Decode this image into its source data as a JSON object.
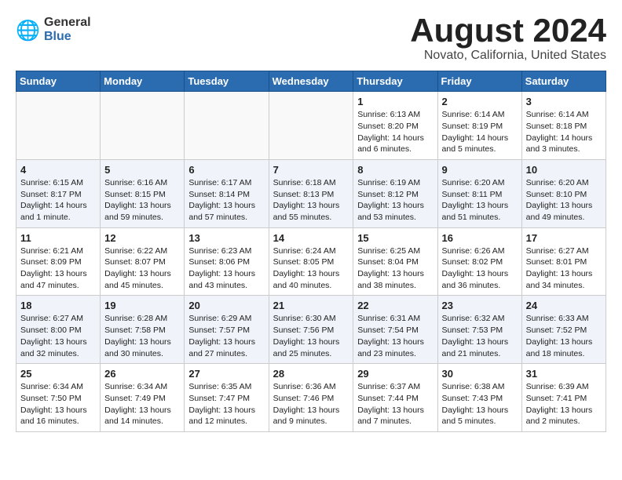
{
  "logo": {
    "general": "General",
    "blue": "Blue"
  },
  "title": {
    "month_year": "August 2024",
    "location": "Novato, California, United States"
  },
  "calendar": {
    "headers": [
      "Sunday",
      "Monday",
      "Tuesday",
      "Wednesday",
      "Thursday",
      "Friday",
      "Saturday"
    ],
    "weeks": [
      [
        {
          "day": "",
          "info": ""
        },
        {
          "day": "",
          "info": ""
        },
        {
          "day": "",
          "info": ""
        },
        {
          "day": "",
          "info": ""
        },
        {
          "day": "1",
          "info": "Sunrise: 6:13 AM\nSunset: 8:20 PM\nDaylight: 14 hours\nand 6 minutes."
        },
        {
          "day": "2",
          "info": "Sunrise: 6:14 AM\nSunset: 8:19 PM\nDaylight: 14 hours\nand 5 minutes."
        },
        {
          "day": "3",
          "info": "Sunrise: 6:14 AM\nSunset: 8:18 PM\nDaylight: 14 hours\nand 3 minutes."
        }
      ],
      [
        {
          "day": "4",
          "info": "Sunrise: 6:15 AM\nSunset: 8:17 PM\nDaylight: 14 hours\nand 1 minute."
        },
        {
          "day": "5",
          "info": "Sunrise: 6:16 AM\nSunset: 8:15 PM\nDaylight: 13 hours\nand 59 minutes."
        },
        {
          "day": "6",
          "info": "Sunrise: 6:17 AM\nSunset: 8:14 PM\nDaylight: 13 hours\nand 57 minutes."
        },
        {
          "day": "7",
          "info": "Sunrise: 6:18 AM\nSunset: 8:13 PM\nDaylight: 13 hours\nand 55 minutes."
        },
        {
          "day": "8",
          "info": "Sunrise: 6:19 AM\nSunset: 8:12 PM\nDaylight: 13 hours\nand 53 minutes."
        },
        {
          "day": "9",
          "info": "Sunrise: 6:20 AM\nSunset: 8:11 PM\nDaylight: 13 hours\nand 51 minutes."
        },
        {
          "day": "10",
          "info": "Sunrise: 6:20 AM\nSunset: 8:10 PM\nDaylight: 13 hours\nand 49 minutes."
        }
      ],
      [
        {
          "day": "11",
          "info": "Sunrise: 6:21 AM\nSunset: 8:09 PM\nDaylight: 13 hours\nand 47 minutes."
        },
        {
          "day": "12",
          "info": "Sunrise: 6:22 AM\nSunset: 8:07 PM\nDaylight: 13 hours\nand 45 minutes."
        },
        {
          "day": "13",
          "info": "Sunrise: 6:23 AM\nSunset: 8:06 PM\nDaylight: 13 hours\nand 43 minutes."
        },
        {
          "day": "14",
          "info": "Sunrise: 6:24 AM\nSunset: 8:05 PM\nDaylight: 13 hours\nand 40 minutes."
        },
        {
          "day": "15",
          "info": "Sunrise: 6:25 AM\nSunset: 8:04 PM\nDaylight: 13 hours\nand 38 minutes."
        },
        {
          "day": "16",
          "info": "Sunrise: 6:26 AM\nSunset: 8:02 PM\nDaylight: 13 hours\nand 36 minutes."
        },
        {
          "day": "17",
          "info": "Sunrise: 6:27 AM\nSunset: 8:01 PM\nDaylight: 13 hours\nand 34 minutes."
        }
      ],
      [
        {
          "day": "18",
          "info": "Sunrise: 6:27 AM\nSunset: 8:00 PM\nDaylight: 13 hours\nand 32 minutes."
        },
        {
          "day": "19",
          "info": "Sunrise: 6:28 AM\nSunset: 7:58 PM\nDaylight: 13 hours\nand 30 minutes."
        },
        {
          "day": "20",
          "info": "Sunrise: 6:29 AM\nSunset: 7:57 PM\nDaylight: 13 hours\nand 27 minutes."
        },
        {
          "day": "21",
          "info": "Sunrise: 6:30 AM\nSunset: 7:56 PM\nDaylight: 13 hours\nand 25 minutes."
        },
        {
          "day": "22",
          "info": "Sunrise: 6:31 AM\nSunset: 7:54 PM\nDaylight: 13 hours\nand 23 minutes."
        },
        {
          "day": "23",
          "info": "Sunrise: 6:32 AM\nSunset: 7:53 PM\nDaylight: 13 hours\nand 21 minutes."
        },
        {
          "day": "24",
          "info": "Sunrise: 6:33 AM\nSunset: 7:52 PM\nDaylight: 13 hours\nand 18 minutes."
        }
      ],
      [
        {
          "day": "25",
          "info": "Sunrise: 6:34 AM\nSunset: 7:50 PM\nDaylight: 13 hours\nand 16 minutes."
        },
        {
          "day": "26",
          "info": "Sunrise: 6:34 AM\nSunset: 7:49 PM\nDaylight: 13 hours\nand 14 minutes."
        },
        {
          "day": "27",
          "info": "Sunrise: 6:35 AM\nSunset: 7:47 PM\nDaylight: 13 hours\nand 12 minutes."
        },
        {
          "day": "28",
          "info": "Sunrise: 6:36 AM\nSunset: 7:46 PM\nDaylight: 13 hours\nand 9 minutes."
        },
        {
          "day": "29",
          "info": "Sunrise: 6:37 AM\nSunset: 7:44 PM\nDaylight: 13 hours\nand 7 minutes."
        },
        {
          "day": "30",
          "info": "Sunrise: 6:38 AM\nSunset: 7:43 PM\nDaylight: 13 hours\nand 5 minutes."
        },
        {
          "day": "31",
          "info": "Sunrise: 6:39 AM\nSunset: 7:41 PM\nDaylight: 13 hours\nand 2 minutes."
        }
      ]
    ]
  }
}
